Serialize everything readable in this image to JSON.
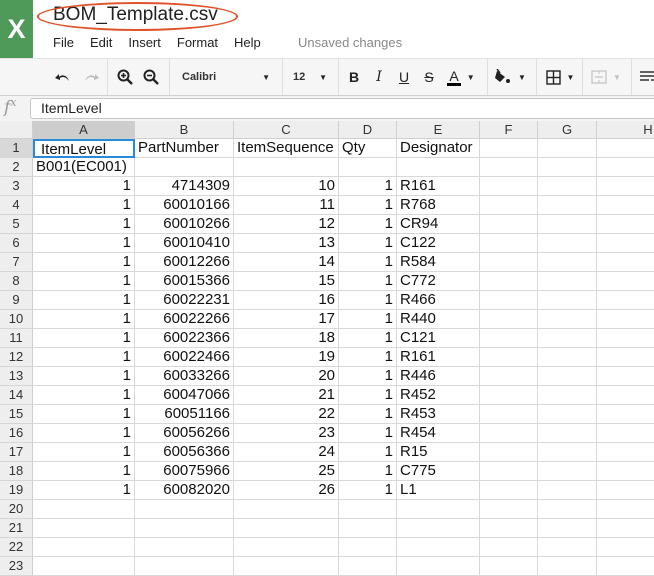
{
  "app": {
    "logo_glyph": "X",
    "file_title": "BOM_Template.csv",
    "status": "Unsaved changes",
    "menu": [
      "File",
      "Edit",
      "Insert",
      "Format",
      "Help"
    ]
  },
  "toolbar": {
    "font_name": "Calibri",
    "font_size": "12",
    "buttons": [
      "undo",
      "redo",
      "zoom-in",
      "zoom-out",
      "bold",
      "italic",
      "underline",
      "strikethrough",
      "text-color",
      "fill-color",
      "borders",
      "merge-cells",
      "wrap-text"
    ],
    "bold_glyph": "B",
    "italic_glyph": "I",
    "underline_glyph": "U",
    "strike_glyph": "S",
    "text_color_glyph": "A"
  },
  "formula_bar": {
    "fx_label": "fx",
    "value": "ItemLevel"
  },
  "sheet": {
    "columns": [
      "A",
      "B",
      "C",
      "D",
      "E",
      "F",
      "G",
      "H"
    ],
    "selected_cell": "A1",
    "rows": [
      {
        "n": "1",
        "cells": [
          "ItemLevel",
          "PartNumber",
          "ItemSequence",
          "Qty",
          "Designator"
        ]
      },
      {
        "n": "2",
        "cells": [
          "B001(EC001)",
          "",
          "",
          "",
          ""
        ]
      },
      {
        "n": "3",
        "cells": [
          "1",
          "4714309",
          "10",
          "1",
          "R161"
        ]
      },
      {
        "n": "4",
        "cells": [
          "1",
          "60010166",
          "11",
          "1",
          "R768"
        ]
      },
      {
        "n": "5",
        "cells": [
          "1",
          "60010266",
          "12",
          "1",
          "CR94"
        ]
      },
      {
        "n": "6",
        "cells": [
          "1",
          "60010410",
          "13",
          "1",
          "C122"
        ]
      },
      {
        "n": "7",
        "cells": [
          "1",
          "60012266",
          "14",
          "1",
          "R584"
        ]
      },
      {
        "n": "8",
        "cells": [
          "1",
          "60015366",
          "15",
          "1",
          "C772"
        ]
      },
      {
        "n": "9",
        "cells": [
          "1",
          "60022231",
          "16",
          "1",
          "R466"
        ]
      },
      {
        "n": "10",
        "cells": [
          "1",
          "60022266",
          "17",
          "1",
          "R440"
        ]
      },
      {
        "n": "11",
        "cells": [
          "1",
          "60022366",
          "18",
          "1",
          "C121"
        ]
      },
      {
        "n": "12",
        "cells": [
          "1",
          "60022466",
          "19",
          "1",
          "R161"
        ]
      },
      {
        "n": "13",
        "cells": [
          "1",
          "60033266",
          "20",
          "1",
          "R446"
        ]
      },
      {
        "n": "14",
        "cells": [
          "1",
          "60047066",
          "21",
          "1",
          "R452"
        ]
      },
      {
        "n": "15",
        "cells": [
          "1",
          "60051166",
          "22",
          "1",
          "R453"
        ]
      },
      {
        "n": "16",
        "cells": [
          "1",
          "60056266",
          "23",
          "1",
          "R454"
        ]
      },
      {
        "n": "17",
        "cells": [
          "1",
          "60056366",
          "24",
          "1",
          "R15"
        ]
      },
      {
        "n": "18",
        "cells": [
          "1",
          "60075966",
          "25",
          "1",
          "C775"
        ]
      },
      {
        "n": "19",
        "cells": [
          "1",
          "60082020",
          "26",
          "1",
          "L1"
        ]
      },
      {
        "n": "20",
        "cells": [
          "",
          "",
          "",
          "",
          ""
        ]
      },
      {
        "n": "21",
        "cells": [
          "",
          "",
          "",
          "",
          ""
        ]
      },
      {
        "n": "22",
        "cells": [
          "",
          "",
          "",
          "",
          ""
        ]
      },
      {
        "n": "23",
        "cells": [
          "",
          "",
          "",
          "",
          ""
        ]
      }
    ]
  }
}
